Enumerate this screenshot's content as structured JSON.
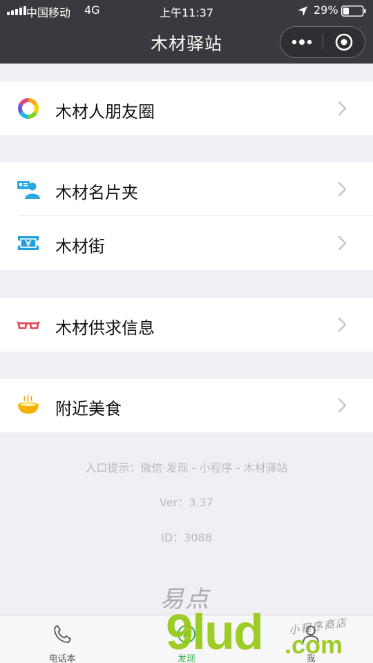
{
  "status_bar": {
    "carrier": "中国移动",
    "network": "4G",
    "time": "上午11:37",
    "battery": "29%"
  },
  "header": {
    "title": "木材驿站",
    "more_icon": "more-dots-icon",
    "close_icon": "target-close-icon"
  },
  "menu": {
    "groups": [
      {
        "items": [
          {
            "label": "木材人朋友圈",
            "icon": "ring-icon"
          }
        ]
      },
      {
        "items": [
          {
            "label": "木材名片夹",
            "icon": "business-card-person-icon"
          },
          {
            "label": "木材街",
            "icon": "ticket-icon"
          }
        ]
      },
      {
        "items": [
          {
            "label": "木材供求信息",
            "icon": "glasses-icon"
          }
        ]
      },
      {
        "items": [
          {
            "label": "附近美食",
            "icon": "food-bowl-icon"
          }
        ]
      }
    ]
  },
  "footer": {
    "hint": "入口提示：微信·发现 - 小程序 - 木材驿站",
    "version": "Ver：3.37",
    "id": "ID：3088"
  },
  "tab_bar": {
    "tabs": [
      {
        "label": "电话本",
        "icon": "phone-icon",
        "active": false
      },
      {
        "label": "发现",
        "icon": "discover-compass-icon",
        "active": true
      },
      {
        "label": "我",
        "icon": "person-icon",
        "active": false
      }
    ]
  },
  "watermark": {
    "brand_cn": "易点",
    "brand_en": "9lud",
    "domain_suffix": ".com",
    "slogan": "小程序商店"
  },
  "colors": {
    "header_bg": "#393a3f",
    "page_bg": "#efeff4",
    "accent_green": "#35b04c",
    "watermark_green": "#96c814"
  }
}
